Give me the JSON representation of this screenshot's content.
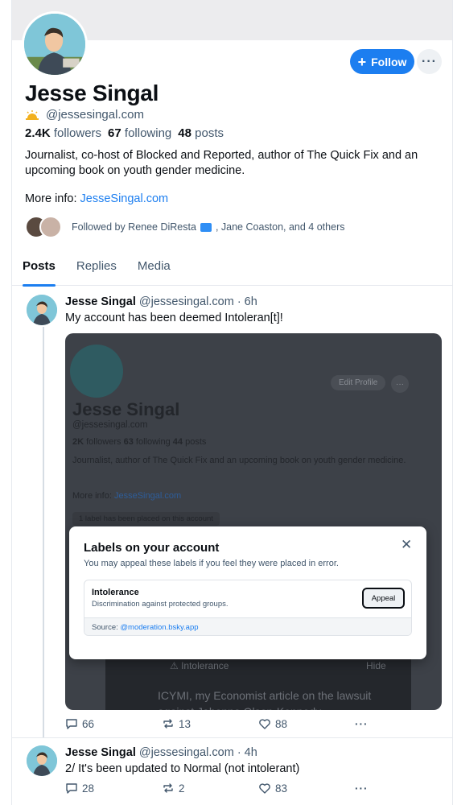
{
  "profile": {
    "name": "Jesse Singal",
    "handle": "@jessesingal.com",
    "followers_count": "2.4K",
    "followers_label": "followers",
    "following_count": "67",
    "following_label": "following",
    "posts_count": "48",
    "posts_label": "posts",
    "bio": "Journalist, co-host of Blocked and Reported, author of The Quick Fix and an upcoming book on youth gender medicine.",
    "more_info_label": "More info:",
    "more_info_link": "JesseSingal.com",
    "follow_label": "Follow",
    "more_label": "···",
    "followed_by_prefix": "Followed by Renee DiResta",
    "followed_by_suffix": ", Jane Coaston, and 4 others"
  },
  "tabs": [
    "Posts",
    "Replies",
    "Media"
  ],
  "posts": [
    {
      "author": "Jesse Singal",
      "handle": "@jessesingal.com",
      "time": "· 6h",
      "text": "My account has been deemed Intoleran[t]!",
      "replies": "66",
      "reposts": "13",
      "likes": "88"
    },
    {
      "author": "Jesse Singal",
      "handle": "@jessesingal.com",
      "time": "· 4h",
      "text": "2/ It's been updated to Normal (not intolerant)",
      "replies": "28",
      "reposts": "2",
      "likes": "83"
    }
  ],
  "embed": {
    "edit_profile": "Edit Profile",
    "name": "Jesse Singal",
    "handle": "@jessesingal.com",
    "followers_count": "2K",
    "followers_label": "followers",
    "following_count": "63",
    "following_label": "following",
    "posts_count": "44",
    "posts_label": "posts",
    "bio": "Journalist, author of The Quick Fix and an upcoming book on youth gender medicine.",
    "more_info_label": "More info:",
    "more_info_link": "JesseSingal.com",
    "label_chip": "1 label has been placed on this account",
    "warning": "Intolerance",
    "hide": "Hide",
    "icymi": "ICYMI, my Economist article on the lawsuit against Jahanna Olson-Kennedy"
  },
  "modal": {
    "title": "Labels on your account",
    "subtitle": "You may appeal these labels if you feel they were placed in error.",
    "label_name": "Intolerance",
    "label_desc": "Discrimination against protected groups.",
    "appeal": "Appeal",
    "source_prefix": "Source:",
    "source_link": "@moderation.bsky.app"
  },
  "colors": {
    "accent": "#1c7ef0",
    "text_muted": "#42576c"
  }
}
